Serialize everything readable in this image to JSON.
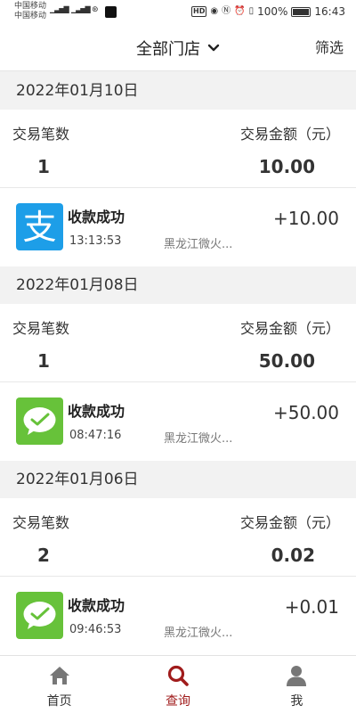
{
  "status_bar": {
    "carrier_1": "中国移动",
    "carrier_2": "中国移动",
    "battery": "100%",
    "time": "16:43"
  },
  "header": {
    "title": "全部门店",
    "filter_label": "筛选"
  },
  "summary_labels": {
    "count": "交易笔数",
    "amount": "交易金额（元）"
  },
  "groups": [
    {
      "date": "2022年01月10日",
      "count": "1",
      "amount": "10.00",
      "transactions": [
        {
          "icon": "alipay-icon",
          "status": "收款成功",
          "time": "13:13:53",
          "store": "黑龙江微火...",
          "amount": "+10.00"
        }
      ]
    },
    {
      "date": "2022年01月08日",
      "count": "1",
      "amount": "50.00",
      "transactions": [
        {
          "icon": "wechat-pay-icon",
          "status": "收款成功",
          "time": "08:47:16",
          "store": "黑龙江微火...",
          "amount": "+50.00"
        }
      ]
    },
    {
      "date": "2022年01月06日",
      "count": "2",
      "amount": "0.02",
      "transactions": [
        {
          "icon": "wechat-pay-icon",
          "status": "收款成功",
          "time": "09:46:53",
          "store": "黑龙江微火...",
          "amount": "+0.01"
        }
      ]
    }
  ],
  "nav": {
    "home": "首页",
    "query": "查询",
    "me": "我"
  },
  "colors": {
    "accent": "#a01c1c",
    "alipay": "#1d9ee8",
    "wechat": "#67c23a"
  }
}
